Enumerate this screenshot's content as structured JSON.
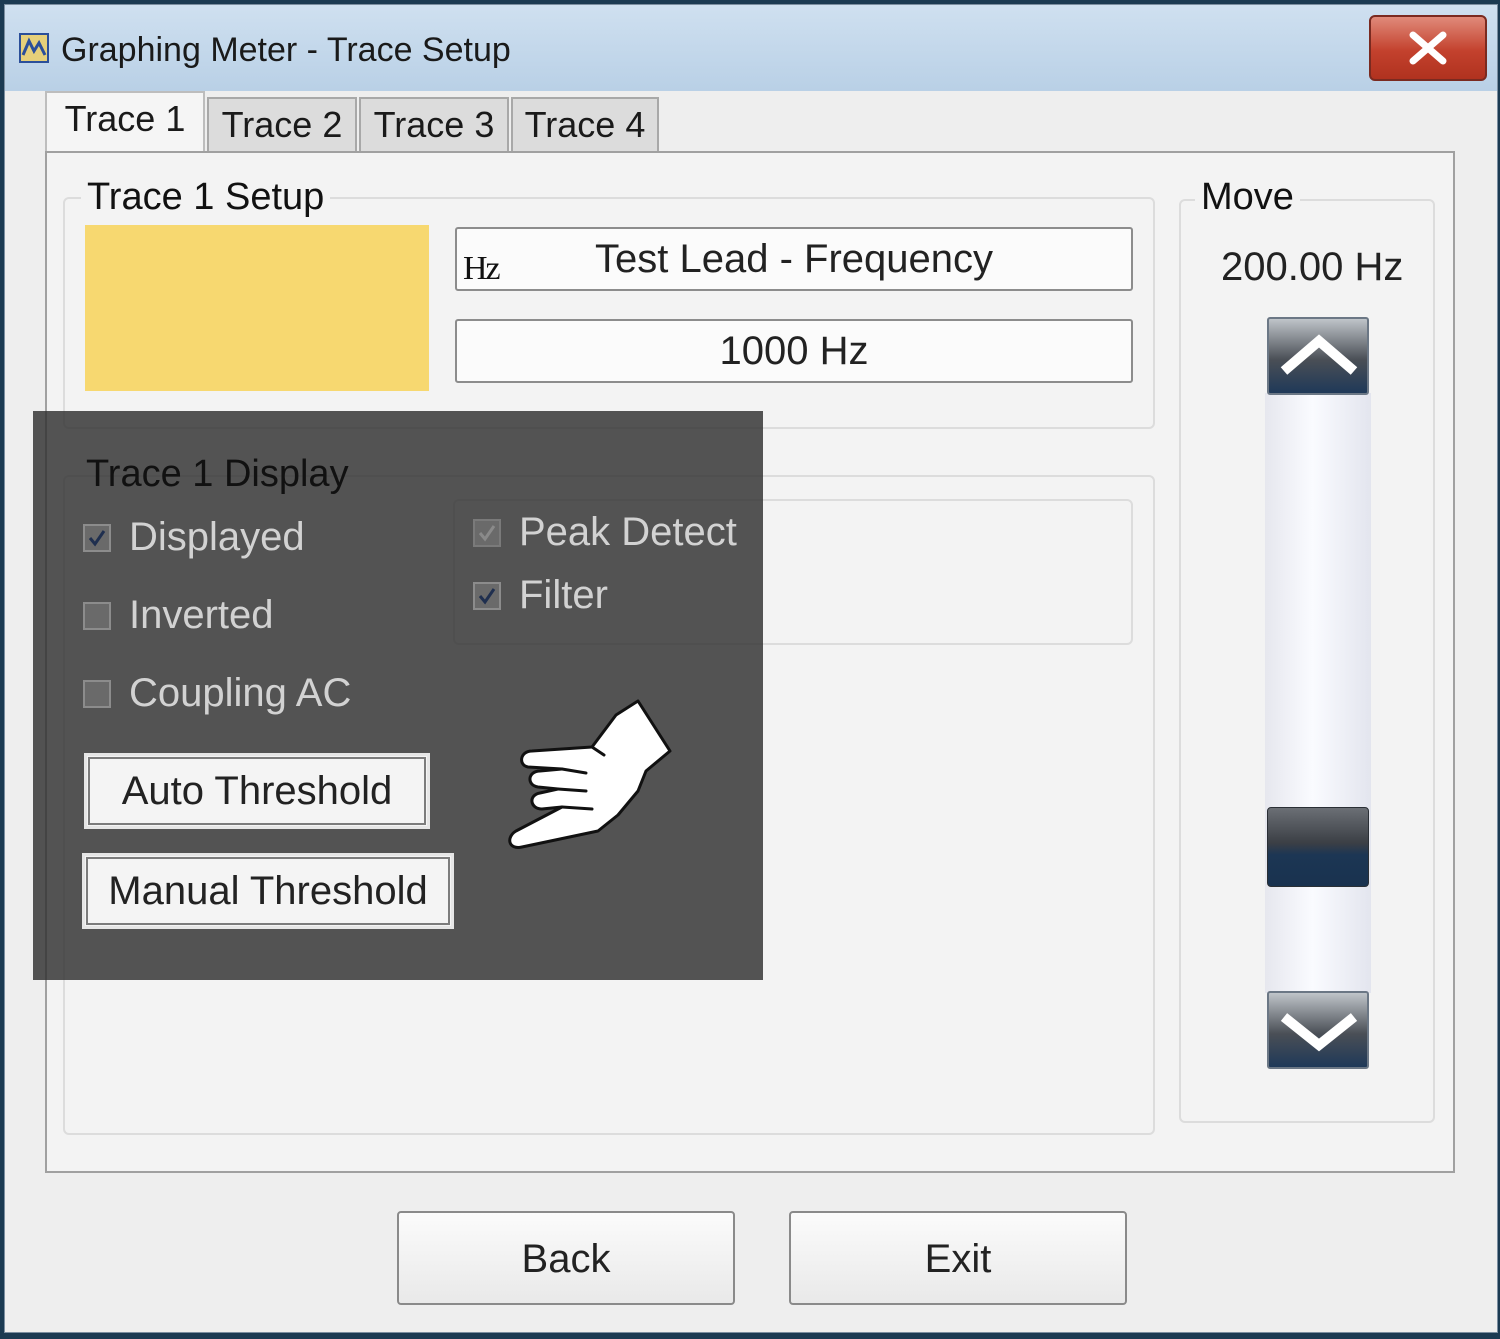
{
  "window": {
    "title": "Graphing Meter - Trace Setup"
  },
  "tabs": [
    {
      "label": "Trace 1",
      "active": true
    },
    {
      "label": "Trace 2",
      "active": false
    },
    {
      "label": "Trace 3",
      "active": false
    },
    {
      "label": "Trace 4",
      "active": false
    }
  ],
  "setup": {
    "legend": "Trace 1 Setup",
    "trace_color": "#f7d870",
    "unit_glyph": "Hz",
    "source": "Test Lead - Frequency",
    "scale": "1000 Hz"
  },
  "display": {
    "legend": "Trace 1 Display",
    "checkboxes": [
      {
        "label": "Displayed",
        "checked": true
      },
      {
        "label": "Inverted",
        "checked": false
      },
      {
        "label": "Coupling AC",
        "checked": false
      }
    ],
    "options": [
      {
        "label": "Peak Detect",
        "checked": true,
        "disabled": true
      },
      {
        "label": "Filter",
        "checked": true
      }
    ],
    "auto_threshold_label": "Auto Threshold",
    "manual_threshold_label": "Manual Threshold"
  },
  "move": {
    "legend": "Move",
    "value": "200.00 Hz"
  },
  "footer": {
    "back_label": "Back",
    "exit_label": "Exit"
  }
}
